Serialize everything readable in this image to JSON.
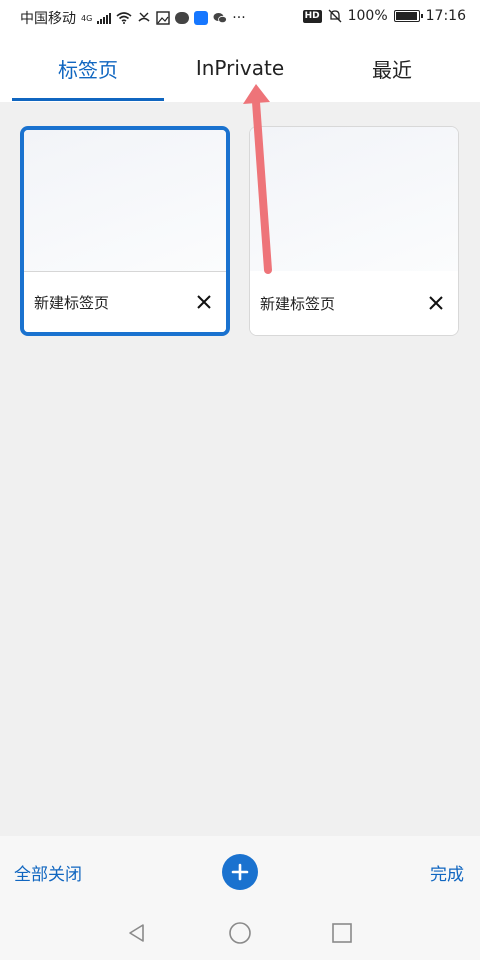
{
  "status_bar": {
    "carrier": "中国移动",
    "network": "4G",
    "more_indicator": "···",
    "hd_badge": "HD",
    "battery_percent": "100%",
    "time": "17:16",
    "icons": [
      "signal-icon",
      "wifi-icon",
      "missed-call-icon",
      "gallery-icon",
      "message-icon",
      "app-notification-icon",
      "wechat-icon",
      "hd-icon",
      "mute-icon",
      "battery-icon"
    ]
  },
  "tabs": [
    {
      "label": "标签页",
      "active": true
    },
    {
      "label": "InPrivate",
      "active": false
    },
    {
      "label": "最近",
      "active": false
    }
  ],
  "tab_cards": [
    {
      "title": "新建标签页",
      "selected": true
    },
    {
      "title": "新建标签页",
      "selected": false
    }
  ],
  "toolbar": {
    "close_all": "全部关闭",
    "add_icon": "plus-icon",
    "done": "完成"
  },
  "nav_bar": {
    "icons": [
      "back-triangle-icon",
      "home-circle-icon",
      "recents-square-icon"
    ]
  },
  "annotation": {
    "arrow_color": "#ee7479"
  },
  "colors": {
    "accent": "#1066c0",
    "content_bg": "#f0f0f0"
  }
}
